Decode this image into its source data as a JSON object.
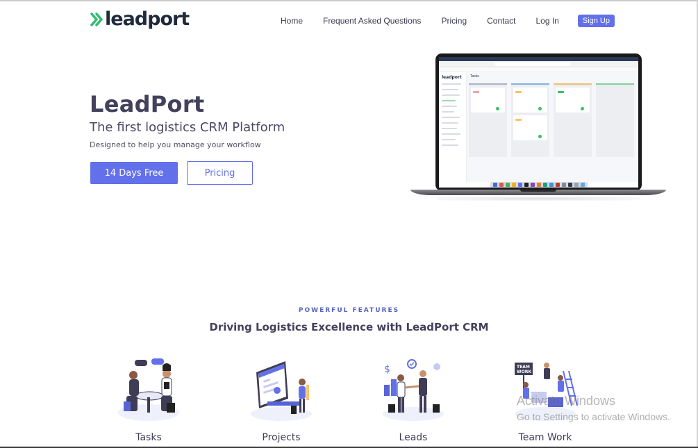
{
  "brand": {
    "name": "leadport",
    "accent": "#6270ea",
    "logo_green": "#2ebd6e"
  },
  "nav": {
    "items": [
      "Home",
      "Frequent Asked Questions",
      "Pricing",
      "Contact",
      "Log In"
    ],
    "signup_label": "Sign Up"
  },
  "hero": {
    "title": "LeadPort",
    "subtitle": "The first logistics CRM Platform",
    "description": "Designed to help you manage your workflow",
    "primary_button": "14 Days Free",
    "secondary_button": "Pricing"
  },
  "laptop_screen": {
    "app_logo": "leadport",
    "page_title": "Tasks"
  },
  "features": {
    "eyebrow": "POWERFUL FEATURES",
    "title": "Driving Logistics Excellence with LeadPort CRM",
    "cards": [
      {
        "label": "Tasks",
        "icon": "meeting-illustration-icon"
      },
      {
        "label": "Projects",
        "icon": "dashboard-illustration-icon"
      },
      {
        "label": "Leads",
        "icon": "handshake-illustration-icon"
      },
      {
        "label": "Team Work",
        "icon": "team-illustration-icon"
      }
    ]
  },
  "watermark": {
    "title": "Activate Windows",
    "subtitle": "Go to Settings to activate Windows."
  }
}
